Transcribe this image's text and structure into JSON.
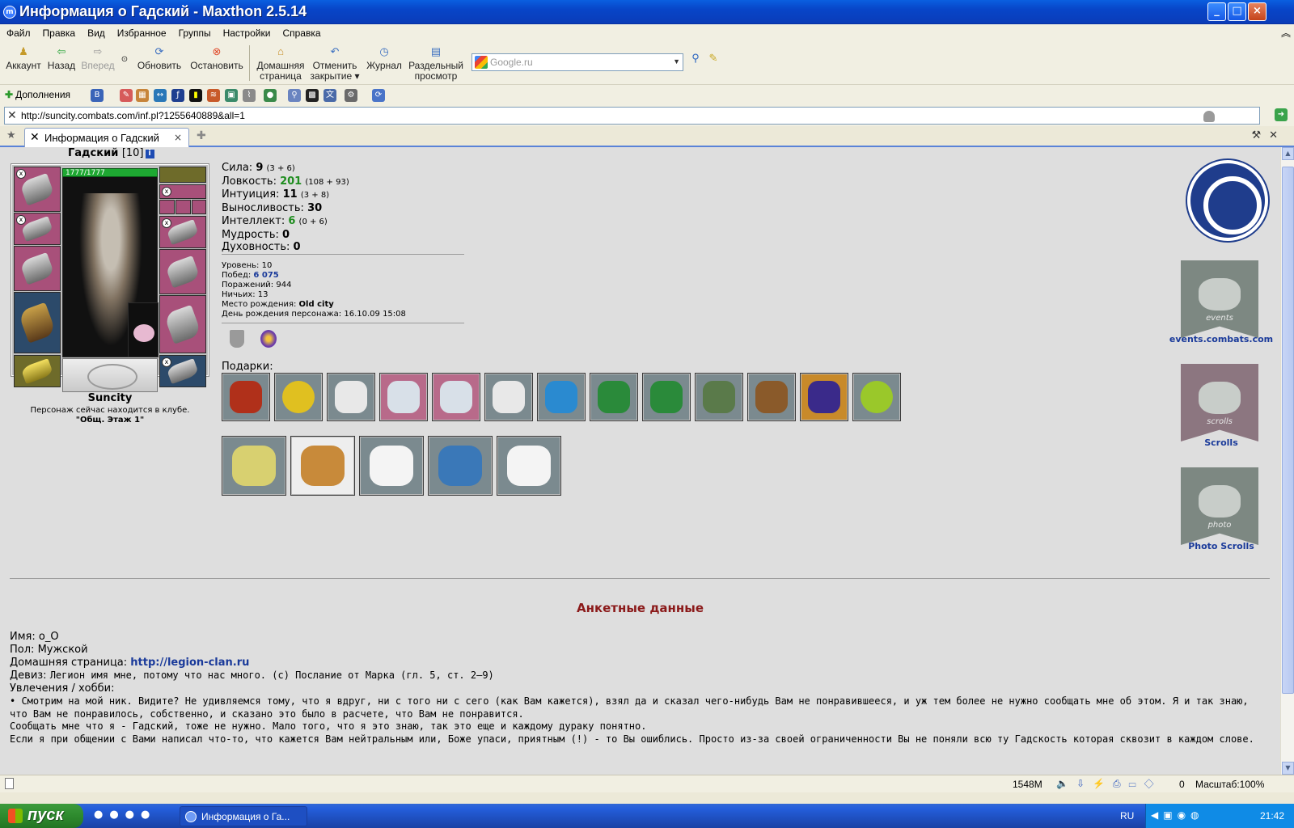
{
  "window": {
    "title": "Информация о Гадский - Maxthon 2.5.14",
    "min": "_",
    "max": "□",
    "close": "×"
  },
  "menu": [
    "Файл",
    "Правка",
    "Вид",
    "Избранное",
    "Группы",
    "Настройки",
    "Справка"
  ],
  "toolbar": {
    "account": "Аккаунт",
    "back": "Назад",
    "forward": "Вперед",
    "refresh": "Обновить",
    "stop": "Остановить",
    "home_1": "Домашняя",
    "home_2": "страница",
    "undo_1": "Отменить",
    "undo_2": "закрытие",
    "history": "Журнал",
    "split_1": "Раздельный",
    "split_2": "просмотр"
  },
  "search": {
    "value": "Google.ru"
  },
  "extbar": {
    "addons": "Дополнения"
  },
  "address": {
    "url": "http://suncity.combats.com/inf.pl?1255640889&all=1"
  },
  "tabs": [
    {
      "label": "Информация о Гадский",
      "close": "×"
    }
  ],
  "character": {
    "name": "Гадский",
    "level": "[10]",
    "hp": "1777/1777",
    "city": "Suncity",
    "location_text": "Персонаж сейчас находится в клубе.",
    "room": "\"Общ. Этаж 1\""
  },
  "stats": {
    "str_l": "Сила: ",
    "str_v": "9",
    "str_s": "(3 + 6)",
    "agi_l": "Ловкость: ",
    "agi_v": "201",
    "agi_s": "(108 + 93)",
    "int_l": "Интуиция: ",
    "int_v": "11",
    "int_s": "(3 + 8)",
    "end_l": "Выносливость: ",
    "end_v": "30",
    "intel_l": "Интеллект: ",
    "intel_v": "6",
    "intel_s": "(0 + 6)",
    "wis_l": "Мудрость: ",
    "wis_v": "0",
    "spi_l": "Духовность: ",
    "spi_v": "0"
  },
  "info": {
    "level_l": "Уровень: ",
    "level_v": "10",
    "wins_l": "Побед: ",
    "wins_v": "6 075",
    "losses_l": "Поражений: ",
    "losses_v": "944",
    "draws_l": "Ничьих: ",
    "draws_v": "13",
    "birthplace_l": "Место рождения: ",
    "birthplace_v": "Old city",
    "birthday_l": "День рождения персонажа: ",
    "birthday_v": "16.10.09 15:08"
  },
  "gifts_label": "Подарки:",
  "sidebar": {
    "events": "events.combats.com",
    "events_banner": "events",
    "scrolls": "Scrolls",
    "scrolls_banner": "scrolls",
    "photo": "Photo Scrolls",
    "photo_banner": "photo"
  },
  "anketa": {
    "title": "Анкетные данные",
    "name_l": "Имя: ",
    "name_v": "o_O",
    "sex_l": "Пол: ",
    "sex_v": "Мужской",
    "home_l": "Домашняя страница: ",
    "home_v": "http://legion-clan.ru",
    "motto_l": "Девиз: ",
    "motto_v": "Легион имя мне, потому что нас много. (с) Послание от Марка (гл. 5, ст. 2—9)",
    "hobby_l": "Увлечения / хобби:",
    "hobby_1": "• Смотрим на мой ник. Видите? Не удивляемся тому, что я вдруг, ни с того ни с сего (как Вам кажется), взял да и сказал чего-нибудь Вам не понравившееся, и уж тем более не нужно сообщать мне об этом. Я и так знаю, что Вам не понравилось, собственно, и сказано это было в расчете, что Вам не понравится.",
    "hobby_2": "Сообщать мне что я - Гадский, тоже не нужно. Мало того, что я это знаю, так это еще и каждому дураку понятно.",
    "hobby_3": "Если я при общении с Вами написал что-то, что кажется Вам нейтральным или, Боже упаси, приятным (!) - то Вы ошиблись. Просто из-за своей ограниченности Вы не поняли всю ту Гадскость которая сквозит в каждом слове."
  },
  "status": {
    "mem": "1548M",
    "count": "0",
    "zoom": "Масштаб:100%"
  },
  "taskbar": {
    "start": "пуск",
    "task": "Информация о Га...",
    "lang": "RU",
    "clock": "21:42"
  }
}
